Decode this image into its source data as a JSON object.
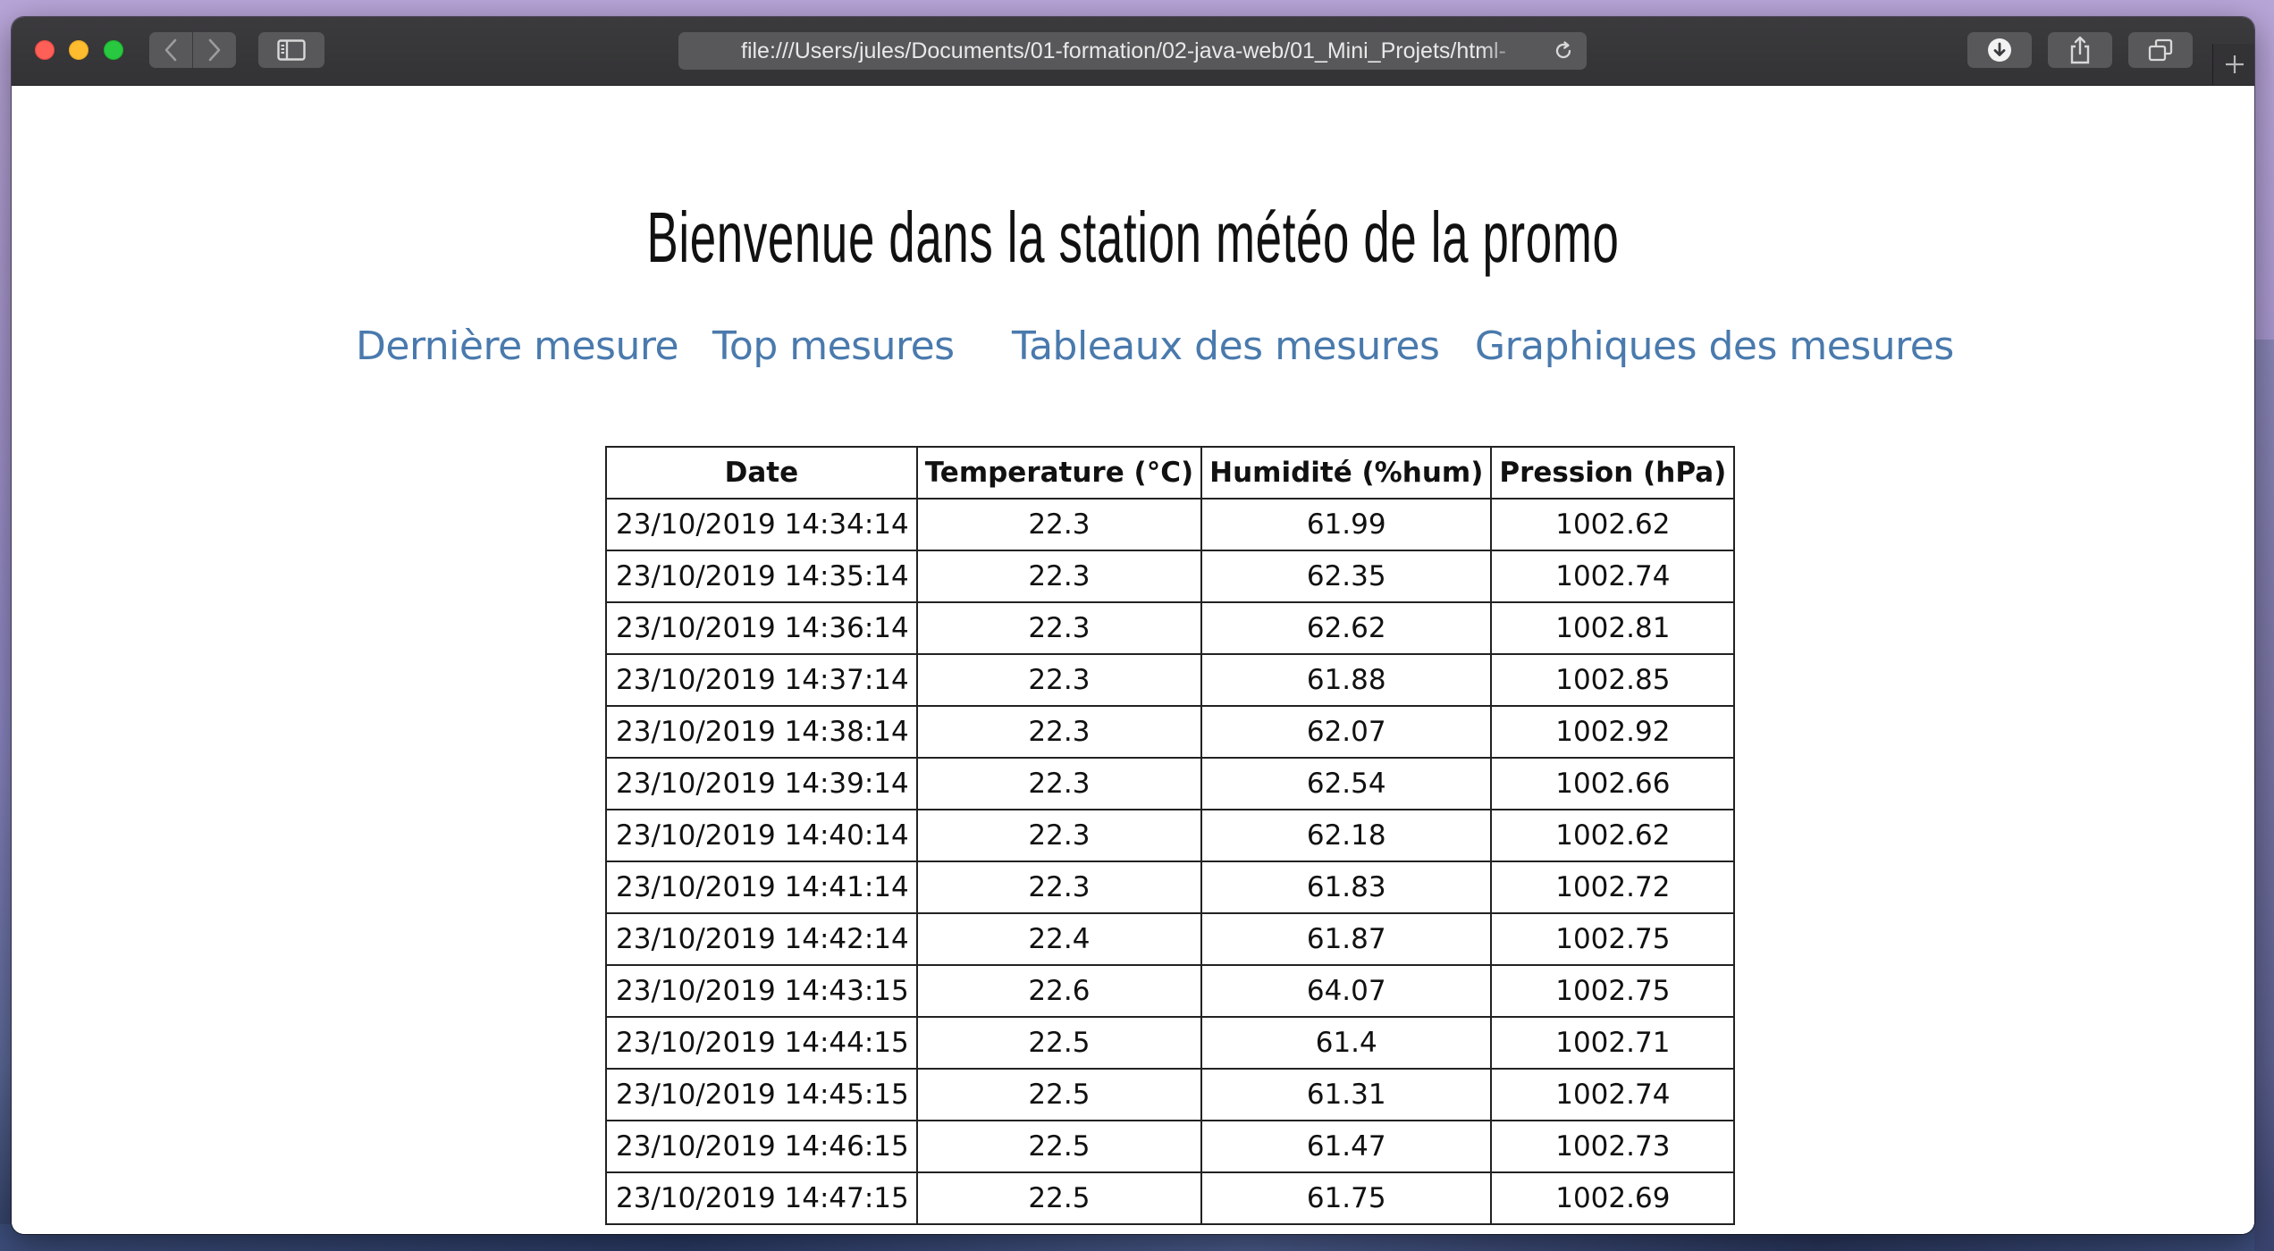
{
  "browser": {
    "url": "file:///Users/jules/Documents/01-formation/02-java-web/01_Mini_Projets/html-"
  },
  "page": {
    "title": "Bienvenue dans la station météo de la promo",
    "nav": [
      {
        "label": "Dernière mesure"
      },
      {
        "label": "Top mesures"
      },
      {
        "label": "Tableaux des mesures"
      },
      {
        "label": "Graphiques des mesures"
      }
    ],
    "table": {
      "headers": [
        "Date",
        "Temperature (°C)",
        "Humidité (%hum)",
        "Pression (hPa)"
      ],
      "rows": [
        [
          "23/10/2019 14:34:14",
          "22.3",
          "61.99",
          "1002.62"
        ],
        [
          "23/10/2019 14:35:14",
          "22.3",
          "62.35",
          "1002.74"
        ],
        [
          "23/10/2019 14:36:14",
          "22.3",
          "62.62",
          "1002.81"
        ],
        [
          "23/10/2019 14:37:14",
          "22.3",
          "61.88",
          "1002.85"
        ],
        [
          "23/10/2019 14:38:14",
          "22.3",
          "62.07",
          "1002.92"
        ],
        [
          "23/10/2019 14:39:14",
          "22.3",
          "62.54",
          "1002.66"
        ],
        [
          "23/10/2019 14:40:14",
          "22.3",
          "62.18",
          "1002.62"
        ],
        [
          "23/10/2019 14:41:14",
          "22.3",
          "61.83",
          "1002.72"
        ],
        [
          "23/10/2019 14:42:14",
          "22.4",
          "61.87",
          "1002.75"
        ],
        [
          "23/10/2019 14:43:15",
          "22.6",
          "64.07",
          "1002.75"
        ],
        [
          "23/10/2019 14:44:15",
          "22.5",
          "61.4",
          "1002.71"
        ],
        [
          "23/10/2019 14:45:15",
          "22.5",
          "61.31",
          "1002.74"
        ],
        [
          "23/10/2019 14:46:15",
          "22.5",
          "61.47",
          "1002.73"
        ],
        [
          "23/10/2019 14:47:15",
          "22.5",
          "61.75",
          "1002.69"
        ]
      ]
    }
  },
  "colors": {
    "link": "#4a7aad",
    "titlebar": "#363538"
  },
  "icons": [
    "back-icon",
    "forward-icon",
    "sidebar-icon",
    "reload-icon",
    "download-icon",
    "share-icon",
    "tabs-icon",
    "plus-icon"
  ]
}
